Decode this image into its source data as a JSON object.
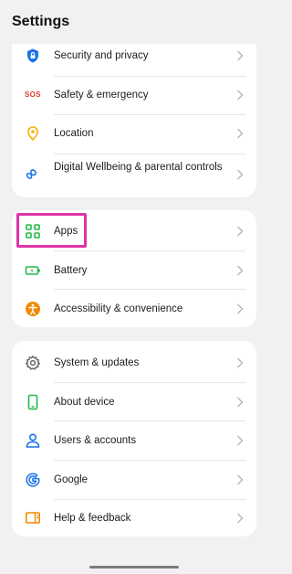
{
  "header": {
    "title": "Settings"
  },
  "groups": [
    {
      "items": [
        {
          "label": "Security and privacy",
          "icon": "shield-lock-icon"
        },
        {
          "label": "Safety & emergency",
          "icon": "sos-icon",
          "icon_text": "SOS"
        },
        {
          "label": "Location",
          "icon": "location-pin-icon"
        },
        {
          "label": "Digital Wellbeing & parental controls",
          "icon": "wellbeing-icon"
        }
      ]
    },
    {
      "items": [
        {
          "label": "Apps",
          "icon": "apps-grid-icon"
        },
        {
          "label": "Battery",
          "icon": "battery-icon"
        },
        {
          "label": "Accessibility & convenience",
          "icon": "accessibility-icon"
        }
      ]
    },
    {
      "items": [
        {
          "label": "System & updates",
          "icon": "gear-icon"
        },
        {
          "label": "About device",
          "icon": "phone-icon"
        },
        {
          "label": "Users & accounts",
          "icon": "user-icon"
        },
        {
          "label": "Google",
          "icon": "google-icon"
        },
        {
          "label": "Help & feedback",
          "icon": "help-feedback-icon"
        }
      ]
    }
  ],
  "colors": {
    "blue": "#1a73e8",
    "red": "#e0392b",
    "yellow": "#f2b200",
    "green": "#22b84a",
    "orange": "#f08a00",
    "gray": "#6b6b6b",
    "highlight": "#e033a8"
  }
}
